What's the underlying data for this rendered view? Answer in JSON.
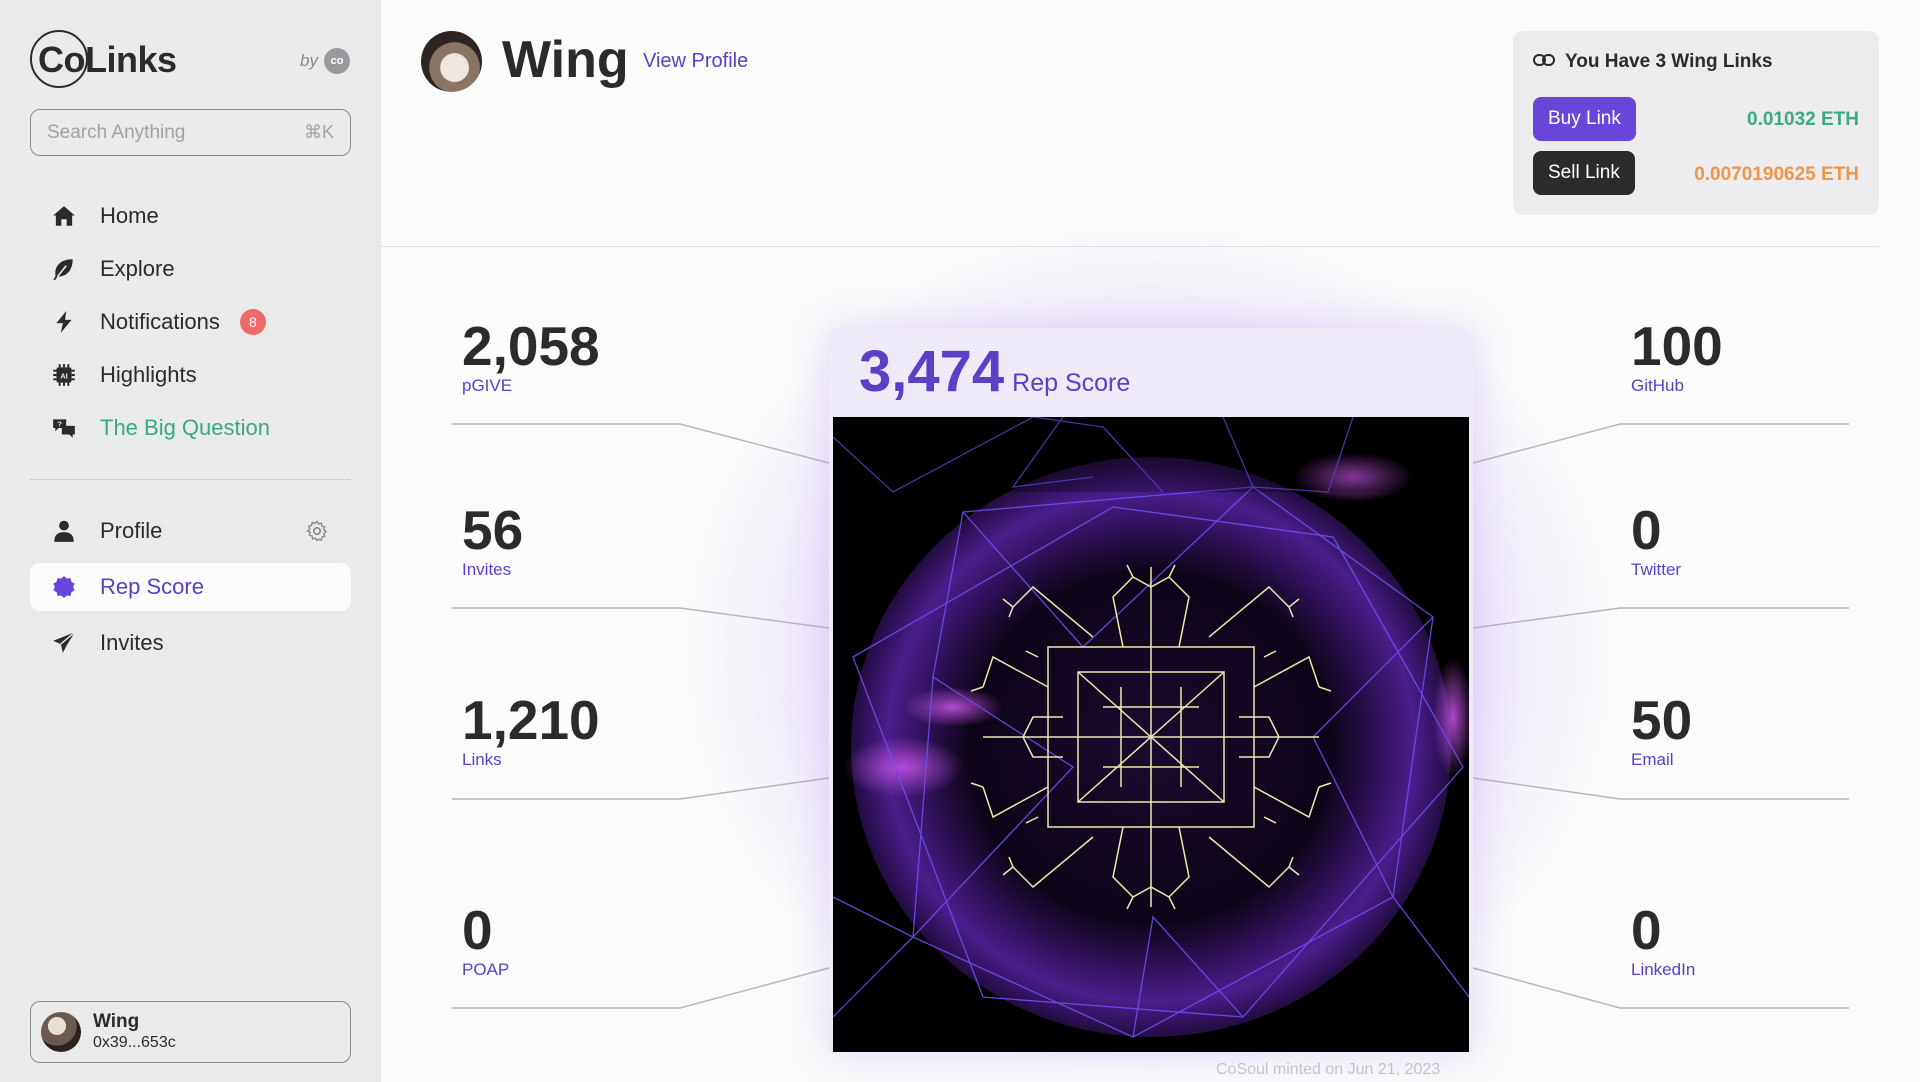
{
  "sidebar": {
    "logo": "CoLinks",
    "by_label": "by",
    "co_badge": "co",
    "search": {
      "placeholder": "Search Anything",
      "shortcut": "⌘K"
    },
    "nav": [
      {
        "label": "Home",
        "icon": "home-icon"
      },
      {
        "label": "Explore",
        "icon": "leaf-icon"
      },
      {
        "label": "Notifications",
        "icon": "bolt-icon",
        "badge": "8"
      },
      {
        "label": "Highlights",
        "icon": "ai-chip-icon"
      },
      {
        "label": "The Big Question",
        "icon": "chat-bubbles-icon"
      }
    ],
    "nav2": [
      {
        "label": "Profile",
        "icon": "person-icon"
      },
      {
        "label": "Rep Score",
        "icon": "badge-icon",
        "active": true
      },
      {
        "label": "Invites",
        "icon": "paper-plane-icon"
      }
    ],
    "user": {
      "name": "Wing",
      "address": "0x39...653c"
    }
  },
  "header": {
    "name": "Wing",
    "view_profile": "View Profile"
  },
  "links": {
    "title": "You Have 3 Wing Links",
    "buy_label": "Buy Link",
    "buy_price": "0.01032 ETH",
    "sell_label": "Sell Link",
    "sell_price": "0.0070190625 ETH"
  },
  "rep": {
    "score": "3,474",
    "label": "Rep Score",
    "minted": "CoSoul minted on Jun 21, 2023"
  },
  "stats_left": [
    {
      "value": "2,058",
      "label": "pGIVE"
    },
    {
      "value": "56",
      "label": "Invites"
    },
    {
      "value": "1,210",
      "label": "Links"
    },
    {
      "value": "0",
      "label": "POAP"
    }
  ],
  "stats_right": [
    {
      "value": "100",
      "label": "GitHub"
    },
    {
      "value": "0",
      "label": "Twitter"
    },
    {
      "value": "50",
      "label": "Email"
    },
    {
      "value": "0",
      "label": "LinkedIn"
    }
  ],
  "colors": {
    "accent": "#5b3fc7",
    "buy_button": "#6a45d9",
    "buy_price": "#3ba886",
    "sell_price": "#f0954a",
    "notification_badge": "#ee6b6b"
  }
}
